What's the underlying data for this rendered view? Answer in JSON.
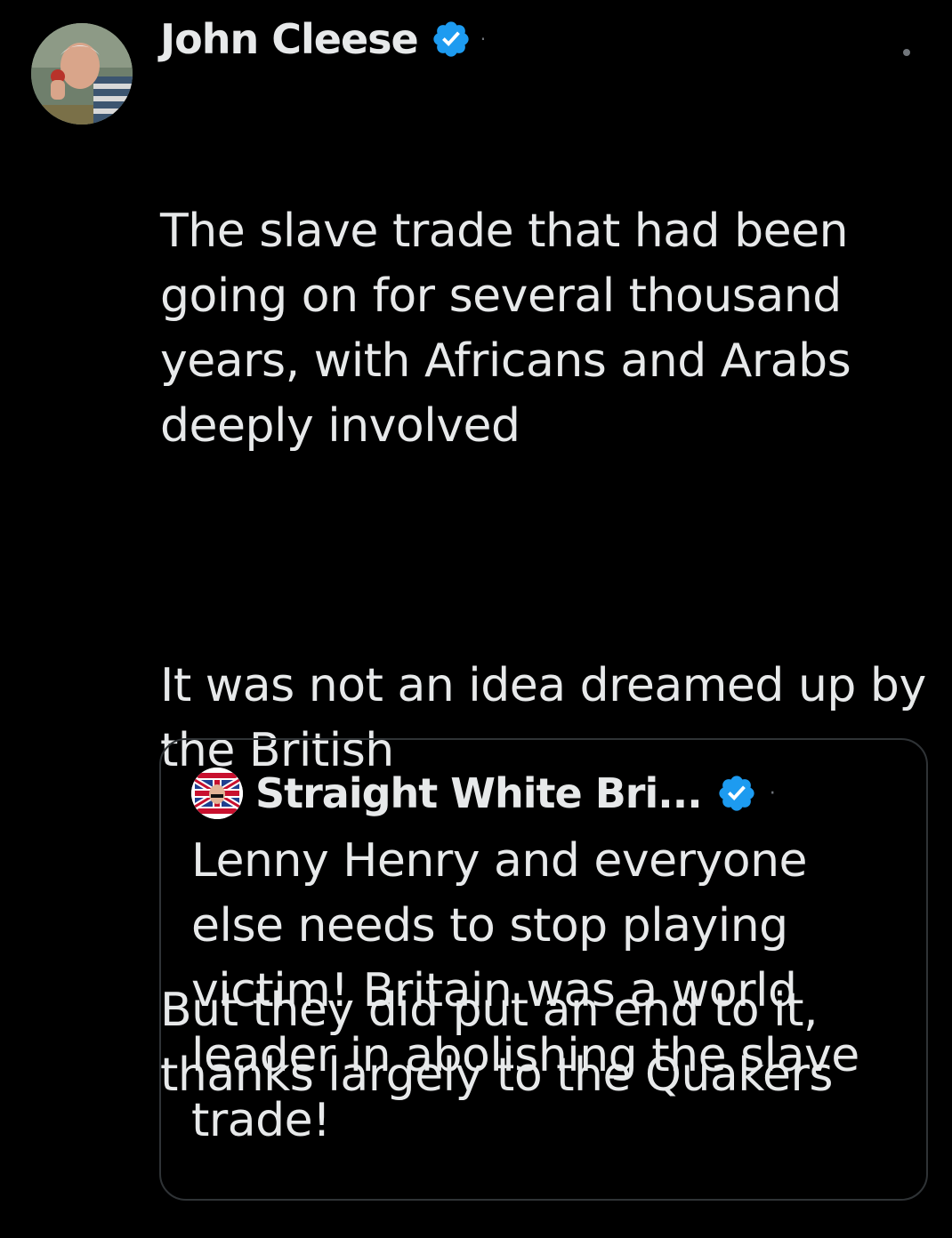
{
  "tweet": {
    "author": {
      "display_name": "John Cleese",
      "verified": true,
      "avatar_icon": "avatar-photo-icon"
    },
    "separator": "·",
    "paragraphs": [
      "The slave trade that had been going on for several thousand years, with Africans and Arabs deeply involved",
      "It was not an idea dreamed up by the British",
      "But they did put an end to it, thanks largely to the Quakers"
    ]
  },
  "quoted_tweet": {
    "author": {
      "display_name": "Straight White Bri...",
      "verified": true,
      "avatar_icon": "union-flag-avatar-icon"
    },
    "separator": "·",
    "text": "Lenny Henry and everyone else needs to stop playing victim! Britain was a world leader in abolishing the slave trade!"
  },
  "colors": {
    "background": "#000000",
    "text": "#e7e9ea",
    "muted": "#71767b",
    "border": "#2f3336",
    "verified_blue": "#1d9bf0"
  }
}
